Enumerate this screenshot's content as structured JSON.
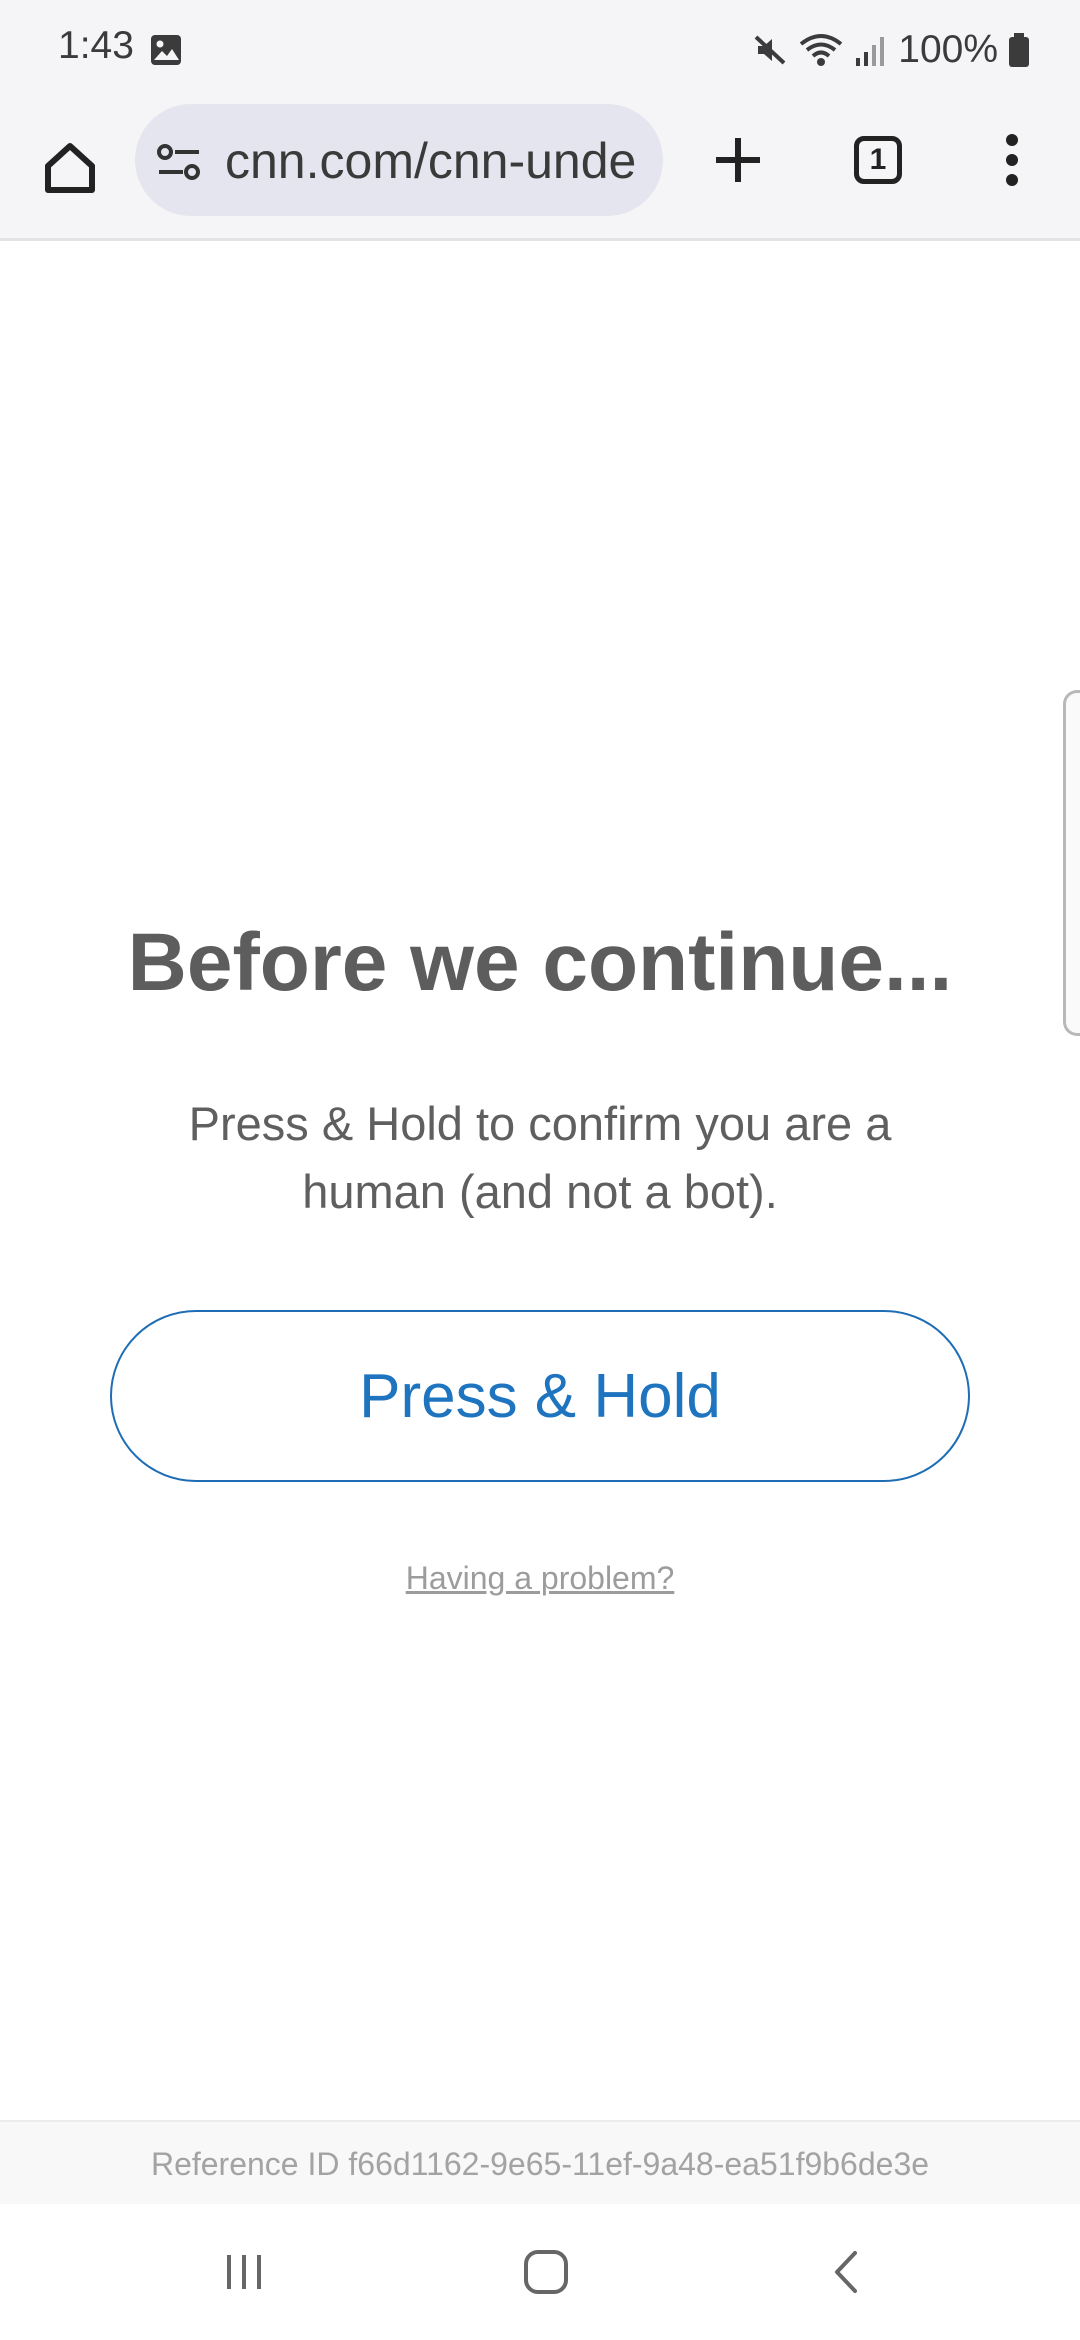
{
  "status_bar": {
    "time": "1:43",
    "battery": "100%",
    "icons": [
      "gallery-notification-icon",
      "mute-icon",
      "wifi-icon",
      "signal-icon",
      "battery-icon"
    ]
  },
  "toolbar": {
    "url": "cnn.com/cnn-unde",
    "tab_count": "1",
    "icons": [
      "home-icon",
      "site-settings-icon",
      "plus-icon",
      "tab-switcher-icon",
      "more-vert-icon"
    ]
  },
  "page": {
    "heading": "Before we continue...",
    "subtext": "Press & Hold to confirm you are a human (and not a bot).",
    "button_label": "Press & Hold",
    "problem_link": "Having a problem?",
    "reference": "Reference ID f66d1162-9e65-11ef-9a48-ea51f9b6de3e",
    "accent_color": "#1e74be"
  },
  "nav_bar": {
    "icons": [
      "recent-apps-icon",
      "home-nav-icon",
      "back-icon"
    ]
  }
}
